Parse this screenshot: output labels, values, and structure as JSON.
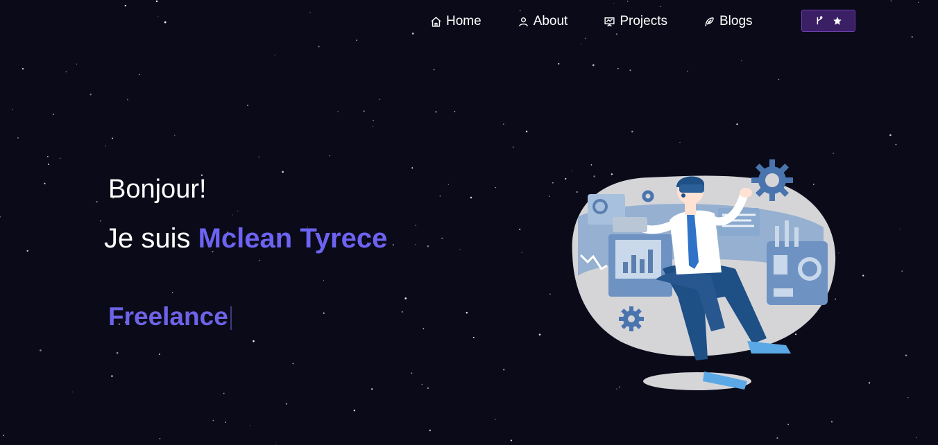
{
  "nav": {
    "items": [
      {
        "label": "Home",
        "icon": "home-icon"
      },
      {
        "label": "About",
        "icon": "user-icon"
      },
      {
        "label": "Projects",
        "icon": "presentation-icon"
      },
      {
        "label": "Blogs",
        "icon": "feather-icon"
      }
    ],
    "repo_button": {
      "icons": [
        "git-fork-icon",
        "star-icon"
      ]
    }
  },
  "hero": {
    "greeting": "Bonjour!",
    "intro_prefix": "Je suis ",
    "name": "Mclean Tyrece",
    "role": "Freelance"
  },
  "colors": {
    "background": "#0b0a19",
    "accent": "#6d63f2",
    "button_bg": "#3b1f64",
    "button_border": "#6c3fb0"
  }
}
